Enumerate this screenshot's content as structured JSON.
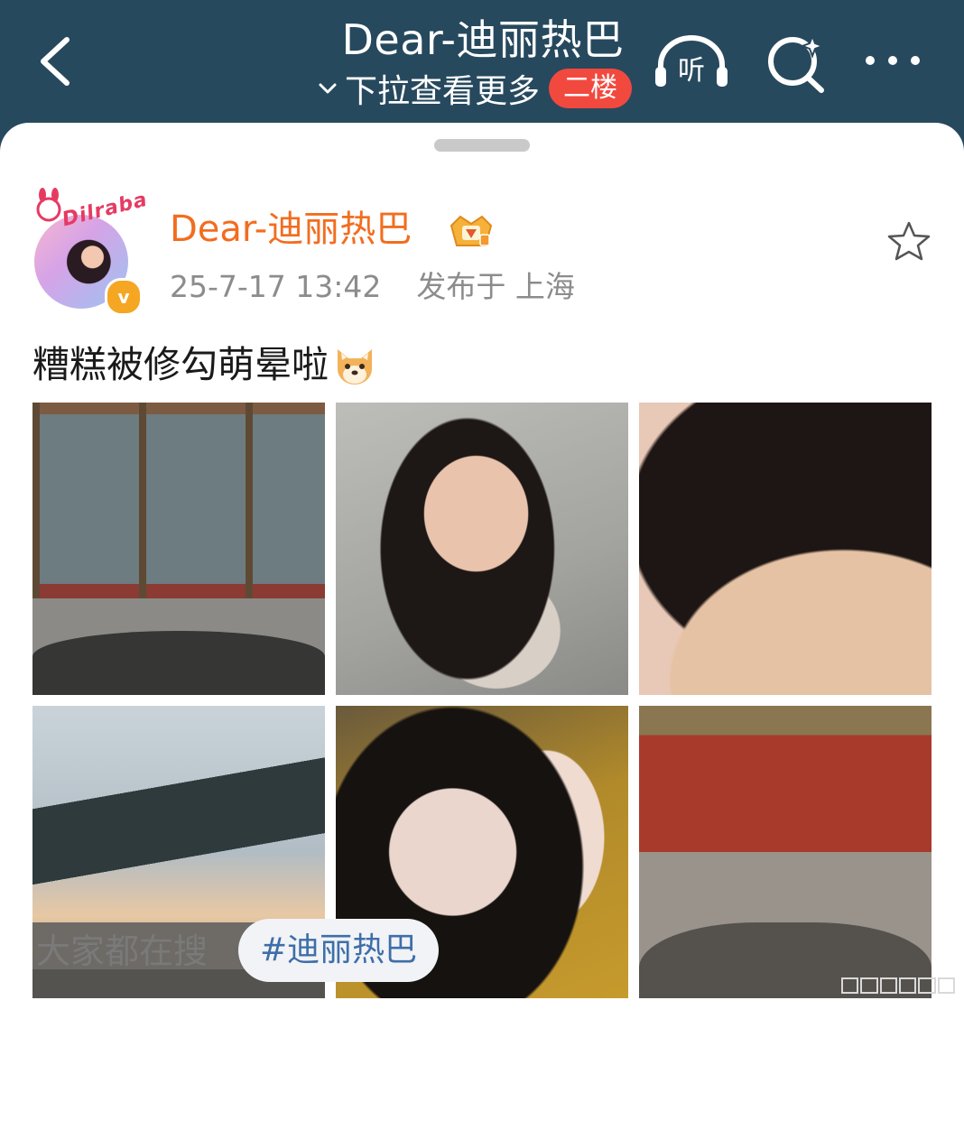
{
  "header": {
    "title": "Dear-迪丽热巴",
    "subtitle": "下拉查看更多",
    "floor_badge": "二楼",
    "listen_label": "听",
    "icons": {
      "back": "chevron-left-icon",
      "dropdown": "chevron-down-icon",
      "listen": "headphones-icon",
      "search": "search-sparkle-icon",
      "more": "more-dots-icon"
    }
  },
  "post": {
    "author": {
      "name": "Dear-迪丽热巴",
      "avatar_text": "Dilraba",
      "verified_mark": "v",
      "badge_icon": "crown-badge-icon"
    },
    "timestamp": "25-7-17 13:42",
    "location": "发布于 上海",
    "text": "糟糕被修勾萌晕啦",
    "emoji_icon": "shiba-dog-emoji",
    "favorite_icon": "star-outline-icon",
    "photos": [
      {
        "name": "photo-1"
      },
      {
        "name": "photo-2"
      },
      {
        "name": "photo-3"
      },
      {
        "name": "photo-4"
      },
      {
        "name": "photo-5"
      },
      {
        "name": "photo-6"
      }
    ]
  },
  "trending": {
    "label": "大家都在搜",
    "tag": "#迪丽热巴"
  },
  "colors": {
    "header_bg": "#27495e",
    "author_name": "#f26d1f",
    "floor_badge": "#f2493f",
    "tag_text": "#3e6ea8",
    "meta_text": "#8c8c8c"
  }
}
